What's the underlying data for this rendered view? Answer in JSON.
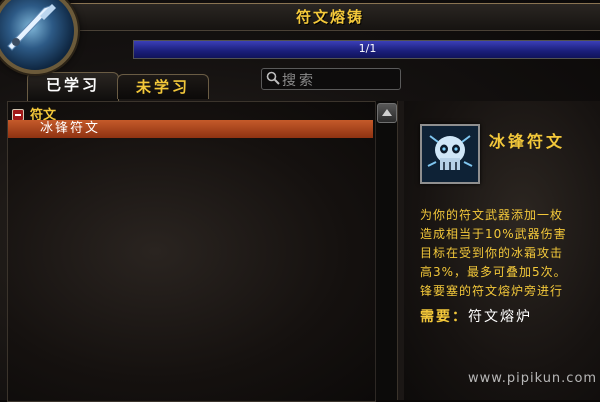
{
  "window": {
    "title": "符文熔铸"
  },
  "progress": {
    "text": "1/1",
    "fraction": 1.0
  },
  "tabs": [
    {
      "label": "已学习",
      "active": true
    },
    {
      "label": "未学习",
      "active": false
    }
  ],
  "search": {
    "placeholder": "搜索"
  },
  "list": {
    "group_label": "符文",
    "items": [
      {
        "label": "冰锋符文",
        "selected": true
      }
    ]
  },
  "detail": {
    "name": "冰锋符文",
    "description_lines": [
      "为你的符文武器添加一枚",
      "造成相当于10%武器伤害",
      "目标在受到你的冰霜攻击",
      "高3%，最多可叠加5次。",
      "锋要塞的符文熔炉旁进行"
    ],
    "requires_label": "需要：",
    "requires_value": "符文熔炉"
  },
  "watermark": "www.pipikun.com",
  "colors": {
    "gold": "#f3c83a",
    "selection": "#c45a2a",
    "progress": "#2a2e9e"
  },
  "icons": {
    "portrait": "frost-weapon-icon",
    "search": "magnifier-icon",
    "scroll_up": "arrow-up-icon",
    "collapse": "minus-icon",
    "spell": "frost-skull-icon"
  }
}
